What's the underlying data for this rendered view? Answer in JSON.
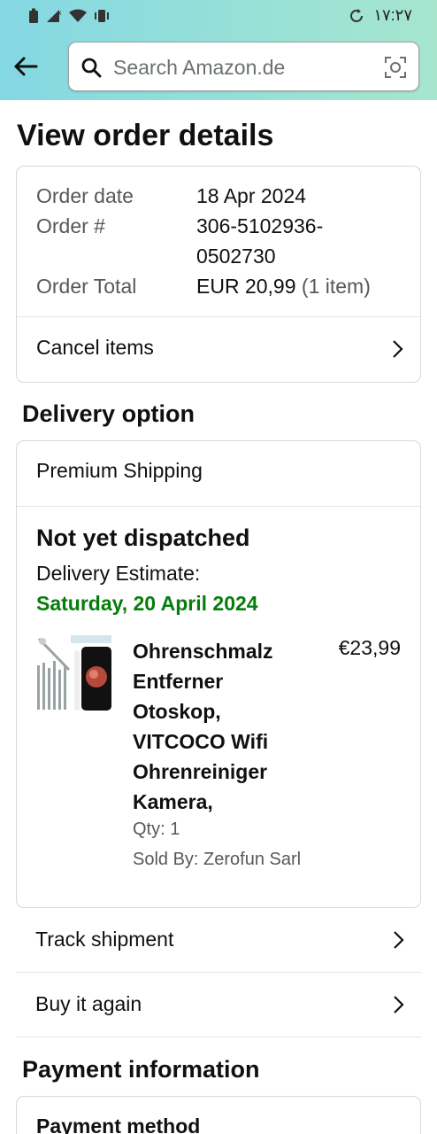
{
  "status_bar": {
    "time": "١٧:٢٧"
  },
  "search": {
    "placeholder": "Search Amazon.de"
  },
  "page_title": "View order details",
  "order": {
    "date_label": "Order date",
    "date_value": "18 Apr 2024",
    "number_label": "Order #",
    "number_line1": "306-5102936-",
    "number_line2": "0502730",
    "total_label": "Order Total",
    "total_value": "EUR 20,99",
    "total_items": "(1 item)",
    "cancel_label": "Cancel items"
  },
  "delivery": {
    "section_title": "Delivery option",
    "shipping_type": "Premium Shipping",
    "status": "Not yet dispatched",
    "estimate_label": "Delivery Estimate:",
    "estimate_date": "Saturday, 20 April 2024",
    "item": {
      "title_lines": [
        "Ohrenschmalz",
        "Entferner",
        "Otoskop,",
        "VITCOCO Wifi",
        "Ohrenreiniger",
        "Kamera,"
      ],
      "price": "€23,99",
      "qty": "Qty: 1",
      "sold_by": "Sold By: Zerofun Sarl"
    },
    "estimate_color": "#067d0b"
  },
  "actions": {
    "track": "Track shipment",
    "buy_again": "Buy it again"
  },
  "payment": {
    "section_title": "Payment information",
    "method_label": "Payment method"
  },
  "icons": {
    "back": "arrow-left-icon",
    "search": "search-icon",
    "camera": "camera-search-icon",
    "chevron": "chevron-right-icon"
  }
}
